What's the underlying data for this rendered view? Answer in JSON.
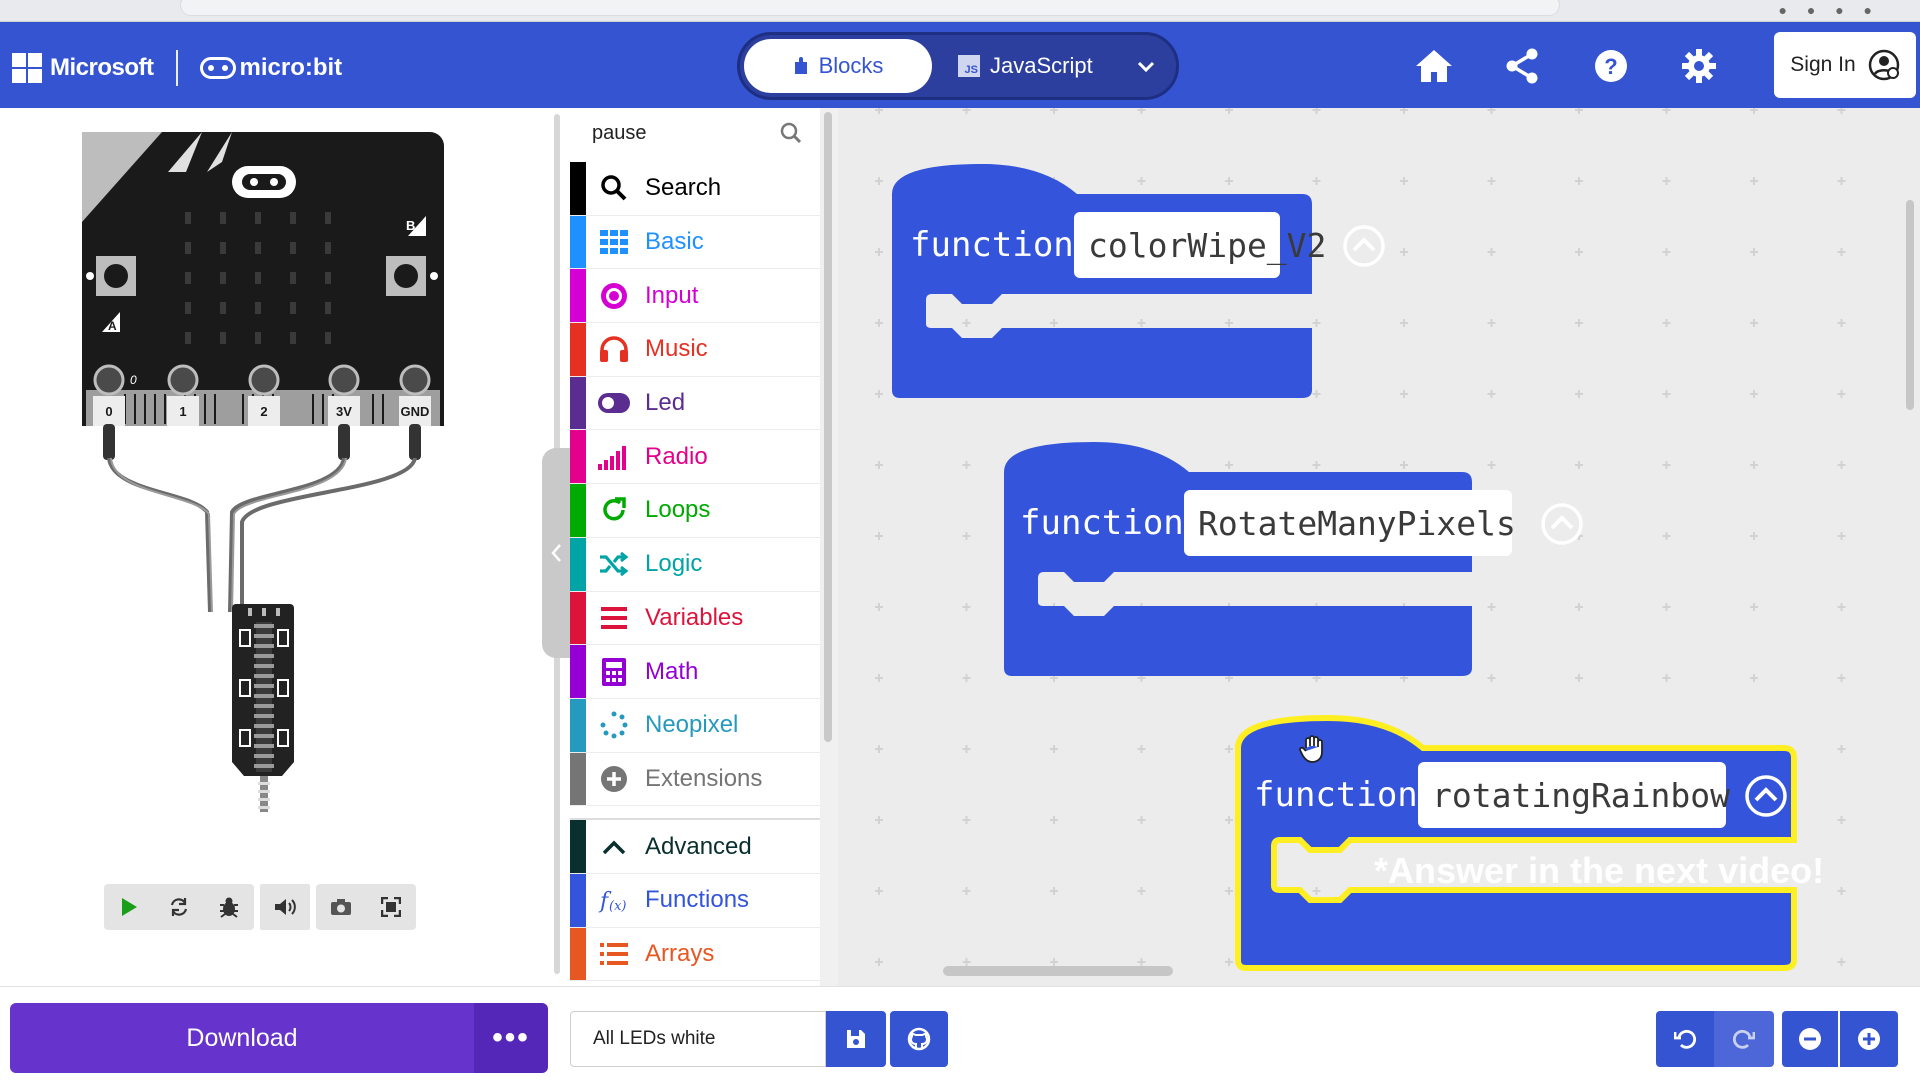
{
  "header": {
    "brand": "Microsoft",
    "product": "micro:bit",
    "editor_tabs": {
      "blocks": "Blocks",
      "javascript": "JavaScript"
    },
    "sign_in": "Sign In"
  },
  "toolbox": {
    "search_value": "pause",
    "categories": [
      {
        "label": "Search",
        "color": "#000000",
        "icon": "search-icon"
      },
      {
        "label": "Basic",
        "color": "#1e90ff",
        "icon": "grid-icon"
      },
      {
        "label": "Input",
        "color": "#d400d4",
        "icon": "target-icon"
      },
      {
        "label": "Music",
        "color": "#e63022",
        "icon": "headphones-icon"
      },
      {
        "label": "Led",
        "color": "#5c2d91",
        "icon": "toggle-icon"
      },
      {
        "label": "Radio",
        "color": "#e3008c",
        "icon": "signal-bars-icon"
      },
      {
        "label": "Loops",
        "color": "#00aa00",
        "icon": "refresh-icon"
      },
      {
        "label": "Logic",
        "color": "#00a4a6",
        "icon": "shuffle-icon"
      },
      {
        "label": "Variables",
        "color": "#dc143c",
        "icon": "list-lines-icon"
      },
      {
        "label": "Math",
        "color": "#9400d3",
        "icon": "calculator-icon"
      },
      {
        "label": "Neopixel",
        "color": "#2699bf",
        "icon": "dots-circle-icon"
      },
      {
        "label": "Extensions",
        "color": "#757575",
        "icon": "plus-circle-icon"
      }
    ],
    "advanced": [
      {
        "label": "Advanced",
        "color": "#0a2f2f",
        "icon": "chevron-up-icon"
      },
      {
        "label": "Functions",
        "color": "#3455db",
        "icon": "function-icon"
      },
      {
        "label": "Arrays",
        "color": "#e65722",
        "icon": "list-icon"
      }
    ]
  },
  "simulator": {
    "pins": [
      "0",
      "1",
      "2",
      "3V",
      "GND"
    ],
    "buttons": [
      "A",
      "B"
    ]
  },
  "workspace": {
    "functions": [
      {
        "keyword": "function",
        "name": "colorWipe_V2"
      },
      {
        "keyword": "function",
        "name": "RotateManyPixels"
      },
      {
        "keyword": "function",
        "name": "rotatingRainbow"
      }
    ],
    "comment": "*Answer in the next video!"
  },
  "bottom": {
    "download": "Download",
    "more": "•••",
    "project_name": "All LEDs white"
  },
  "colors": {
    "header": "#3454d1",
    "block": "#3455db",
    "download": "#6633cc",
    "highlight": "#ffee22"
  }
}
